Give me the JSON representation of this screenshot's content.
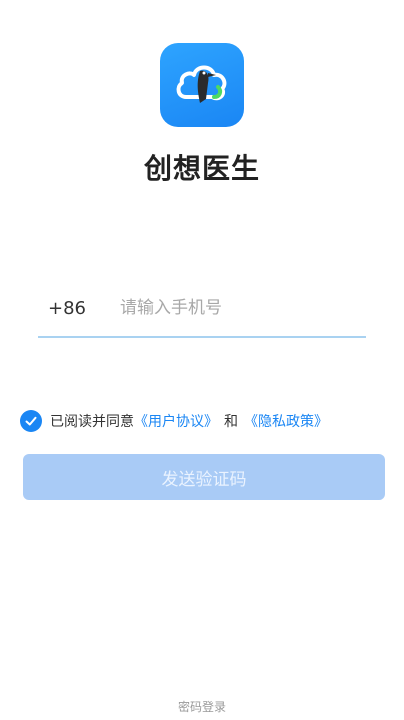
{
  "app": {
    "name": "创想医生",
    "logo_icon": "cloud-woodpecker-logo-icon",
    "brand_color": "#1a86f4"
  },
  "login": {
    "country_code": "+86",
    "phone_placeholder": "请输入手机号",
    "agree_checked": true,
    "agree_prefix": "已阅读并同意",
    "user_agreement": "《用户协议》",
    "and": "和",
    "privacy_policy": "《隐私政策》",
    "send_code_label": "发送验证码",
    "send_code_enabled": false,
    "password_login_label": "密码登录"
  }
}
